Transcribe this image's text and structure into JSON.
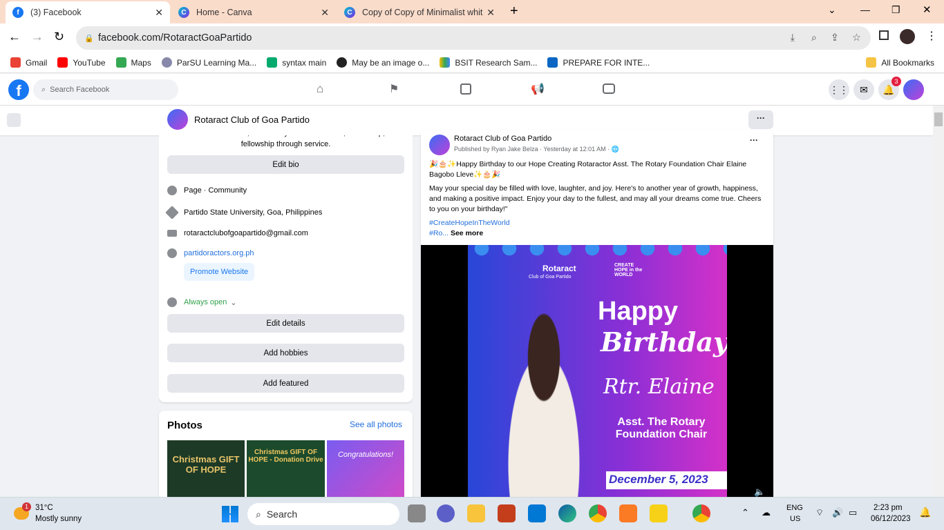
{
  "browser": {
    "tabs": [
      {
        "title": "(3) Facebook",
        "active": true
      },
      {
        "title": "Home - Canva"
      },
      {
        "title": "Copy of Copy of Minimalist whit"
      }
    ],
    "url": "facebook.com/RotaractGoaPartido",
    "bookmarks": [
      "Gmail",
      "YouTube",
      "Maps",
      "ParSU Learning Ma...",
      "syntax main",
      "May be an image o...",
      "BSIT Research Sam...",
      "PREPARE FOR INTE..."
    ],
    "all_bookmarks": "All Bookmarks"
  },
  "fb": {
    "search_placeholder": "Search Facebook",
    "notif_count": "3",
    "page_name": "Rotaract Club of Goa Partido",
    "more": "···"
  },
  "intro": {
    "bio_tail": "Rotaract: Youth-driven, community-focused service, leadership, and",
    "bio_last": "fellowship through service.",
    "edit_bio": "Edit bio",
    "category": "Page · Community",
    "location": "Partido State University, Goa, Philippines",
    "email": "rotaractclubofgoapartido@gmail.com",
    "website": "partidoractors.org.ph",
    "promote": "Promote Website",
    "hours": "Always open",
    "edit_details": "Edit details",
    "add_hobbies": "Add hobbies",
    "add_featured": "Add featured"
  },
  "photos": {
    "title": "Photos",
    "see_all": "See all photos",
    "items": [
      "Christmas GIFT OF HOPE",
      "Christmas GIFT OF HOPE - Donation Drive",
      "Congratulations!"
    ]
  },
  "post": {
    "author": "Rotaract Club of Goa Partido",
    "meta": "Published by Ryan Jake Belza · Yesterday at 12:01 AM ·",
    "line1": "🎉🎂✨Happy Birthday to our Hope Creating Rotaractor Asst. The Rotary Foundation Chair Elaine Bagobo Lleve✨🎂🎉",
    "line2": "May your special day be filled with love, laughter, and joy. Here's to another year of growth, happiness, and making a positive impact. Enjoy your day to the fullest, and may all your dreams come true. Cheers to you on your birthday!\"",
    "hashtag": "#CreateHopeInTheWorld",
    "hashtag2": "#Ro...",
    "see_more": "See more",
    "image": {
      "brand": "Rotaract",
      "club": "Club of Goa Partido",
      "slogan": "CREATE HOPE in the WORLD",
      "happy": "Happy",
      "birthday": "Birthday",
      "name": "Rtr. Elaine",
      "role": "Asst. The Rotary Foundation Chair",
      "date": "December 5, 2023"
    }
  },
  "taskbar": {
    "weather_temp": "31°C",
    "weather_desc": "Mostly sunny",
    "weather_badge": "1",
    "search": "Search",
    "lang1": "ENG",
    "lang2": "US",
    "time": "2:23 pm",
    "date": "06/12/2023"
  }
}
